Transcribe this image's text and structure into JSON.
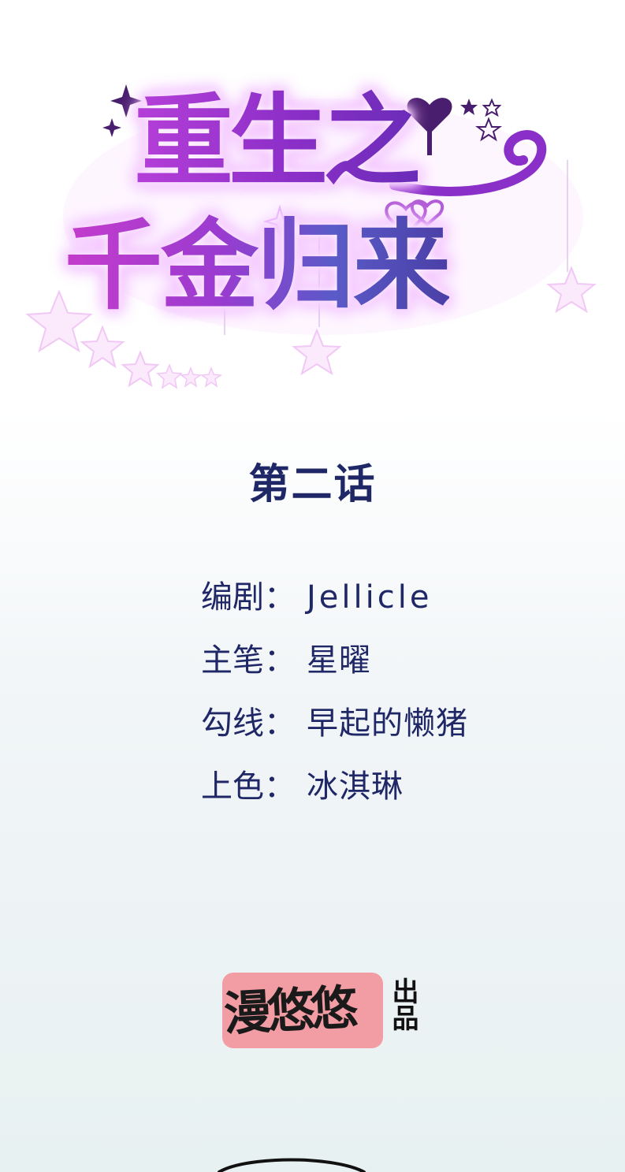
{
  "title": {
    "line1": "重生之",
    "line2": "千金归来"
  },
  "chapter": "第二话",
  "credits": [
    {
      "label": "编剧：",
      "value": "Jellicle"
    },
    {
      "label": "主笔：",
      "value": "星曜"
    },
    {
      "label": "勾线：",
      "value": "早起的懒猪"
    },
    {
      "label": "上色：",
      "value": "冰淇琳"
    }
  ],
  "publisher": {
    "name": "漫悠悠",
    "suffix": "出品"
  },
  "colors": {
    "title_purple": "#9b3bd0",
    "title_pink": "#c43ccc",
    "text_navy": "#1f2766",
    "badge_pink": "#f29ca3"
  },
  "icons": [
    "sparkle-icon",
    "heart-icon",
    "star-icon",
    "swirl-icon"
  ]
}
